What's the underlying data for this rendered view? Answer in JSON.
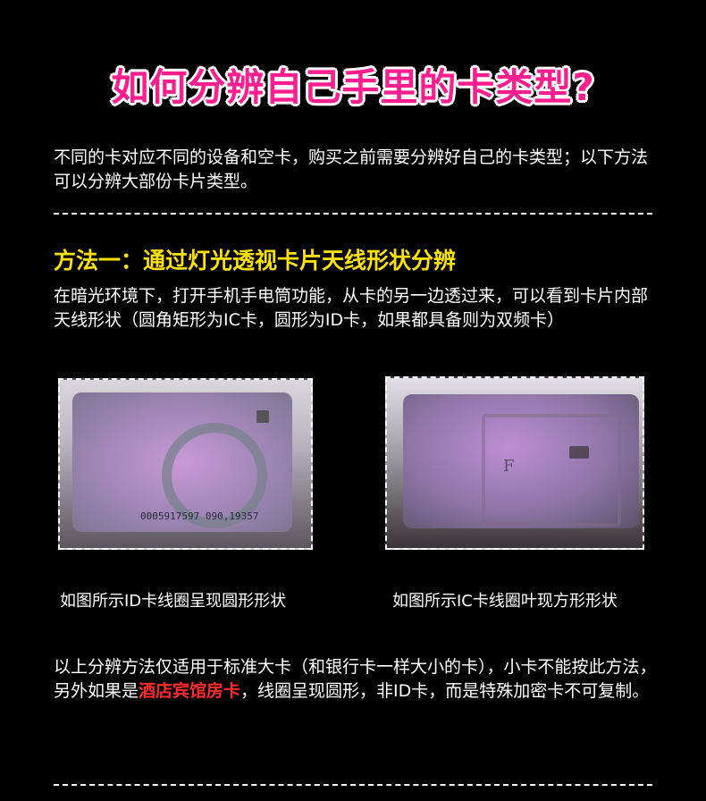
{
  "title": "如何分辨自己手里的卡类型?",
  "intro": "不同的卡对应不同的设备和空卡，购买之前需要分辨好自己的卡类型；以下方法可以分辨大部份卡片类型。",
  "method1": {
    "heading": "方法一：通过灯光透视卡片天线形状分辨",
    "description": "在暗光环境下，打开手机手电筒功能，从卡的另一边透过来，可以看到卡片内部天线形状（圆角矩形为IC卡，圆形为ID卡，如果都具备则为双频卡）"
  },
  "images": [
    {
      "card_number": "0005917597 090,19357",
      "caption": "如图所示ID卡线圈呈现圆形形状"
    },
    {
      "card_letter": "F",
      "caption": "如图所示IC卡线圈叶现方形形状"
    }
  ],
  "note": {
    "part1": "以上分辨方法仅适用于标准大卡（和银行卡一样大小的卡），小卡不能按此方法，另外如果是",
    "highlight": "酒店宾馆房卡",
    "part2": "，线圈呈现圆形，非ID卡，而是特殊加密卡不可复制。"
  },
  "colors": {
    "title": "#ff1e8e",
    "heading": "#ffe100",
    "highlight": "#ff2b2b",
    "background": "#000000"
  }
}
